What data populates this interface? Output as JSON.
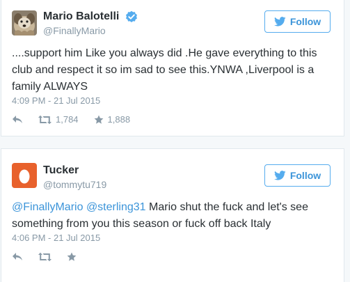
{
  "tweets": [
    {
      "display_name": "Mario Balotelli",
      "screen_name": "@FinallyMario",
      "verified": true,
      "follow_label": "Follow",
      "text": "....support him Like you always did .He gave everything to this club and respect it so im sad to see this.YNWA ,Liverpool is a family ALWAYS",
      "timestamp": "4:09 PM - 21 Jul 2015",
      "retweets": "1,784",
      "likes": "1,888"
    },
    {
      "display_name": "Tucker",
      "screen_name": "@tommytu719",
      "verified": false,
      "follow_label": "Follow",
      "mention_1": "@FinallyMario",
      "mention_2": "@sterling31",
      "text_rest": " Mario shut the fuck and let's see something from you this season or fuck off back Italy",
      "timestamp": "4:06 PM - 21 Jul 2015"
    }
  ],
  "colors": {
    "accent": "#55acee",
    "link": "#3b94d9",
    "muted": "#8899a6",
    "egg_avatar": "#e8612c"
  }
}
